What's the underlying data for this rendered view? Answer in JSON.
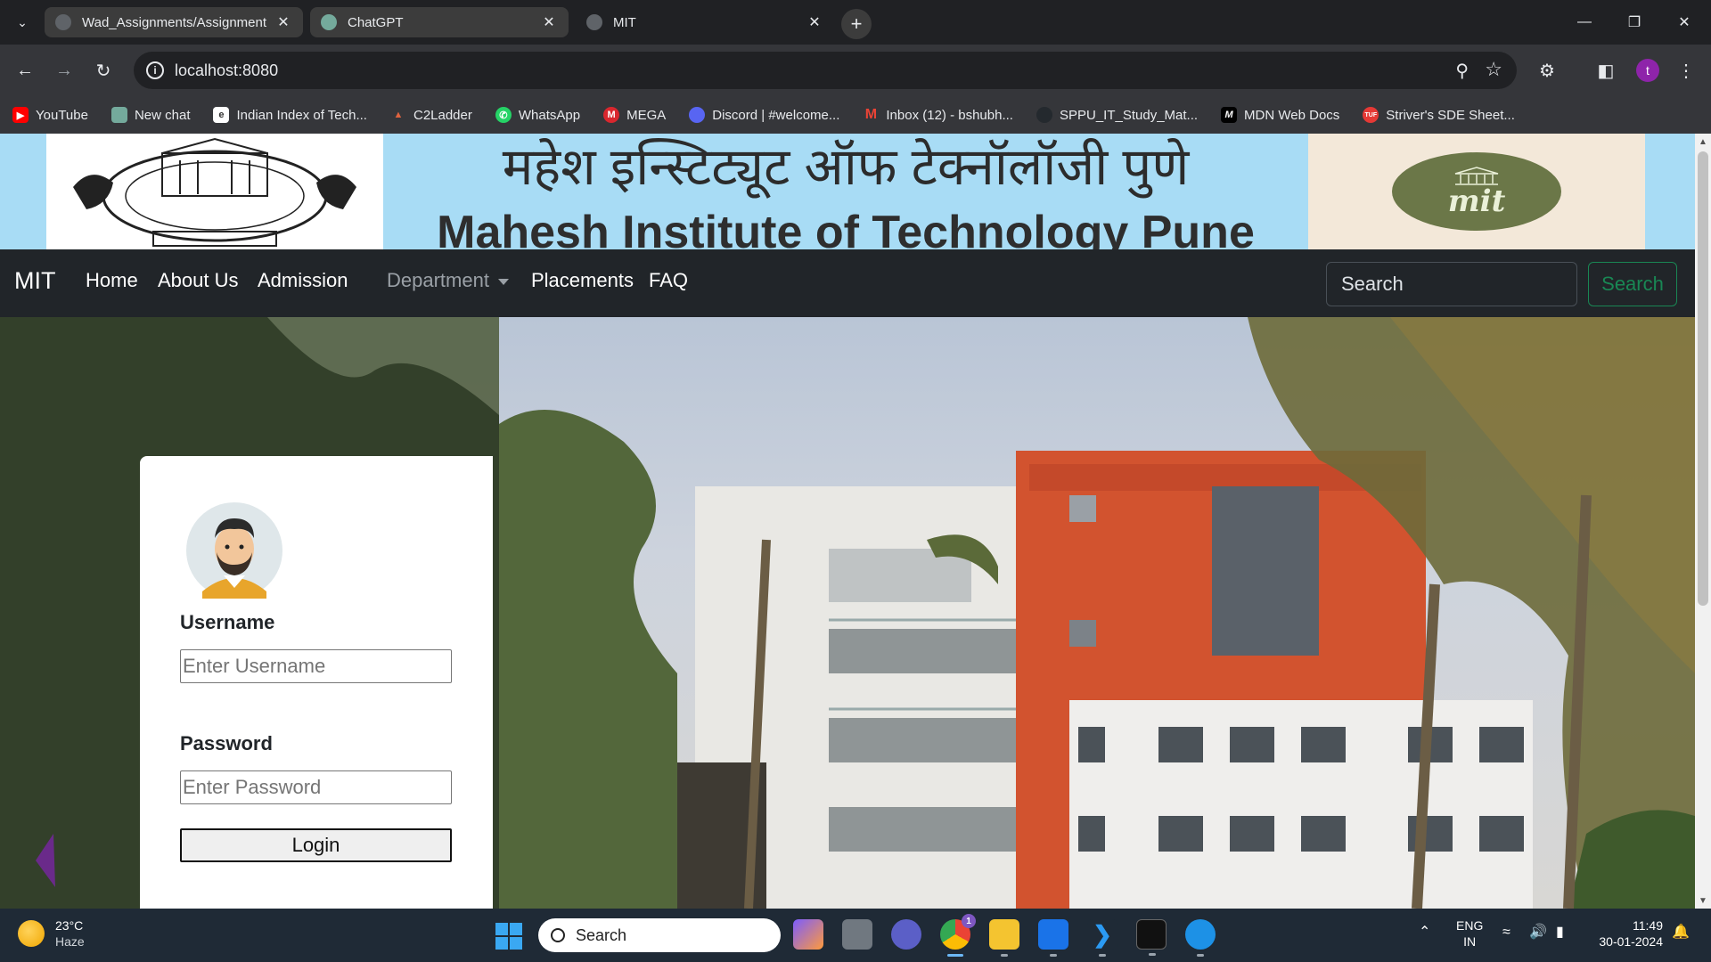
{
  "browser": {
    "tabs": [
      {
        "title": "Wad_Assignments/Assignment",
        "favicon": "github-icon"
      },
      {
        "title": "ChatGPT",
        "favicon": "chatgpt-icon"
      },
      {
        "title": "MIT",
        "favicon": "globe-icon"
      }
    ],
    "url": "localhost:8080",
    "profile_initial": "t",
    "bookmarks": [
      {
        "label": "YouTube",
        "icon": "youtube-icon",
        "color": "#ff0000"
      },
      {
        "label": "New chat",
        "icon": "chatgpt-icon",
        "color": "#74aa9c"
      },
      {
        "label": "Indian Index of Tech...",
        "icon": "index-icon",
        "color": "#ffffff"
      },
      {
        "label": "C2Ladder",
        "icon": "chart-icon",
        "color": "#e0633f"
      },
      {
        "label": "WhatsApp",
        "icon": "whatsapp-icon",
        "color": "#25d366"
      },
      {
        "label": "MEGA",
        "icon": "mega-icon",
        "color": "#d9272e"
      },
      {
        "label": "Discord | #welcome...",
        "icon": "discord-icon",
        "color": "#5865f2"
      },
      {
        "label": "Inbox (12) - bshubh...",
        "icon": "gmail-icon",
        "color": "#ea4335"
      },
      {
        "label": "SPPU_IT_Study_Mat...",
        "icon": "github-icon",
        "color": "#24292e"
      },
      {
        "label": "MDN Web Docs",
        "icon": "mdn-icon",
        "color": "#000000"
      },
      {
        "label": "Striver's SDE Sheet...",
        "icon": "tuf-icon",
        "color": "#e53935"
      }
    ]
  },
  "page": {
    "banner": {
      "hindi_title": "महेश इन्स्टिट्यूट ऑफ टेक्नॉलॉजी पुणे",
      "english_title": "Mahesh Institute of Technology Pune",
      "logo_text": "mit"
    },
    "navbar": {
      "brand": "MIT",
      "links": [
        "Home",
        "About Us",
        "Admission",
        "Department",
        "Placements",
        "FAQ"
      ],
      "search_placeholder": "Search",
      "search_button": "Search"
    },
    "login": {
      "username_label": "Username",
      "username_placeholder": "Enter Username",
      "password_label": "Password",
      "password_placeholder": "Enter Password",
      "login_button": "Login"
    }
  },
  "taskbar": {
    "weather_temp": "23°C",
    "weather_desc": "Haze",
    "search_label": "Search",
    "chrome_badge": "1",
    "lang_line1": "ENG",
    "lang_line2": "IN",
    "time": "11:49",
    "date": "30-01-2024"
  },
  "colors": {
    "banner_bg": "#a8dcf5",
    "navbar_bg": "#212529",
    "search_button_green": "#198754",
    "logo_olive": "#6b7748"
  }
}
